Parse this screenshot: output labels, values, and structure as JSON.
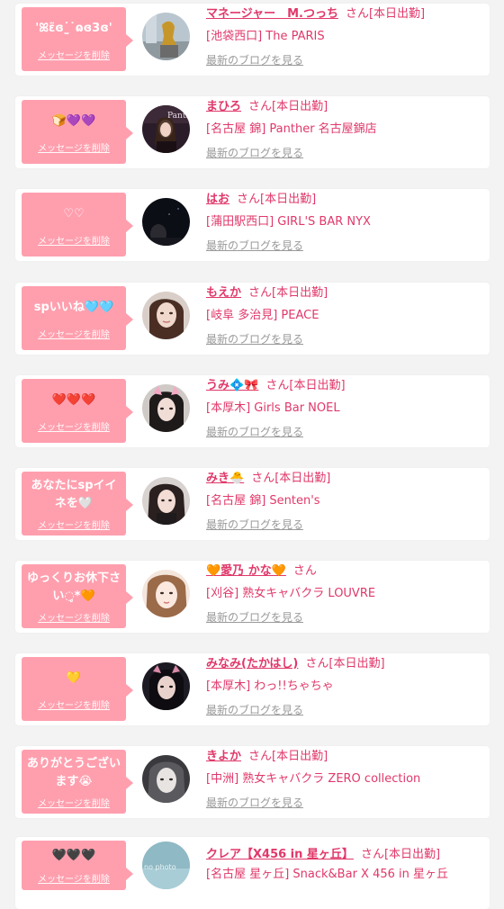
{
  "delete_label": "メッセージを削除",
  "blog_label": "最新のブログを見る",
  "honorific": "さん",
  "cards": [
    {
      "message": "'ꕤɛ̃ɞ˙̫˙ɷɞ3ɞ'",
      "name": "マネージャー　M.つっち",
      "status": "[本日出勤]",
      "shop": "[池袋西口] The PARIS"
    },
    {
      "message": "🍞💜💜",
      "name": "まひろ",
      "status": "[本日出勤]",
      "shop": "[名古屋 錦] Panther 名古屋錦店"
    },
    {
      "message": "♡♡",
      "name": "はお",
      "status": "[本日出勤]",
      "shop": "[蒲田駅西口] GIRL'S BAR NYX"
    },
    {
      "message": "spいいね🩵🩵",
      "name": "もえか",
      "status": "[本日出勤]",
      "shop": "[岐阜 多治見] PEACE"
    },
    {
      "message": "❤️❤️❤️",
      "name": "うみ💠🎀",
      "status": "[本日出勤]",
      "shop": "[本厚木] Girls Bar NOEL"
    },
    {
      "message": "あなたにspイイネを🤍",
      "name": "みき🐣",
      "status": "[本日出勤]",
      "shop": "[名古屋 錦] Senten's"
    },
    {
      "message": "ゆっくりお休下さい◌̥*🧡",
      "name": "🧡愛乃 かな🧡",
      "status": "",
      "shop": "[刈谷] 熟女キャバクラ LOUVRE"
    },
    {
      "message": "💛",
      "name": "みなみ(たかはし)",
      "status": "[本日出勤]",
      "shop": "[本厚木] わっ!!ちゃちゃ"
    },
    {
      "message": "ありがとうございます😭",
      "name": "きよか",
      "status": "[本日出勤]",
      "shop": "[中洲] 熟女キャバクラ ZERO collection"
    },
    {
      "message": "🖤🖤🖤",
      "name": "クレア【X456 in 星ヶ丘】",
      "status": "[本日出勤]",
      "shop": "[名古屋 星ヶ丘] Snack&Bar X 456 in 星ヶ丘"
    }
  ],
  "avatar_text": {
    "a1": "Panther",
    "a9": "no photo"
  },
  "colors": {
    "bubble": "#ff9fae",
    "accent": "#e0386a",
    "muted": "#9a9a9a"
  }
}
